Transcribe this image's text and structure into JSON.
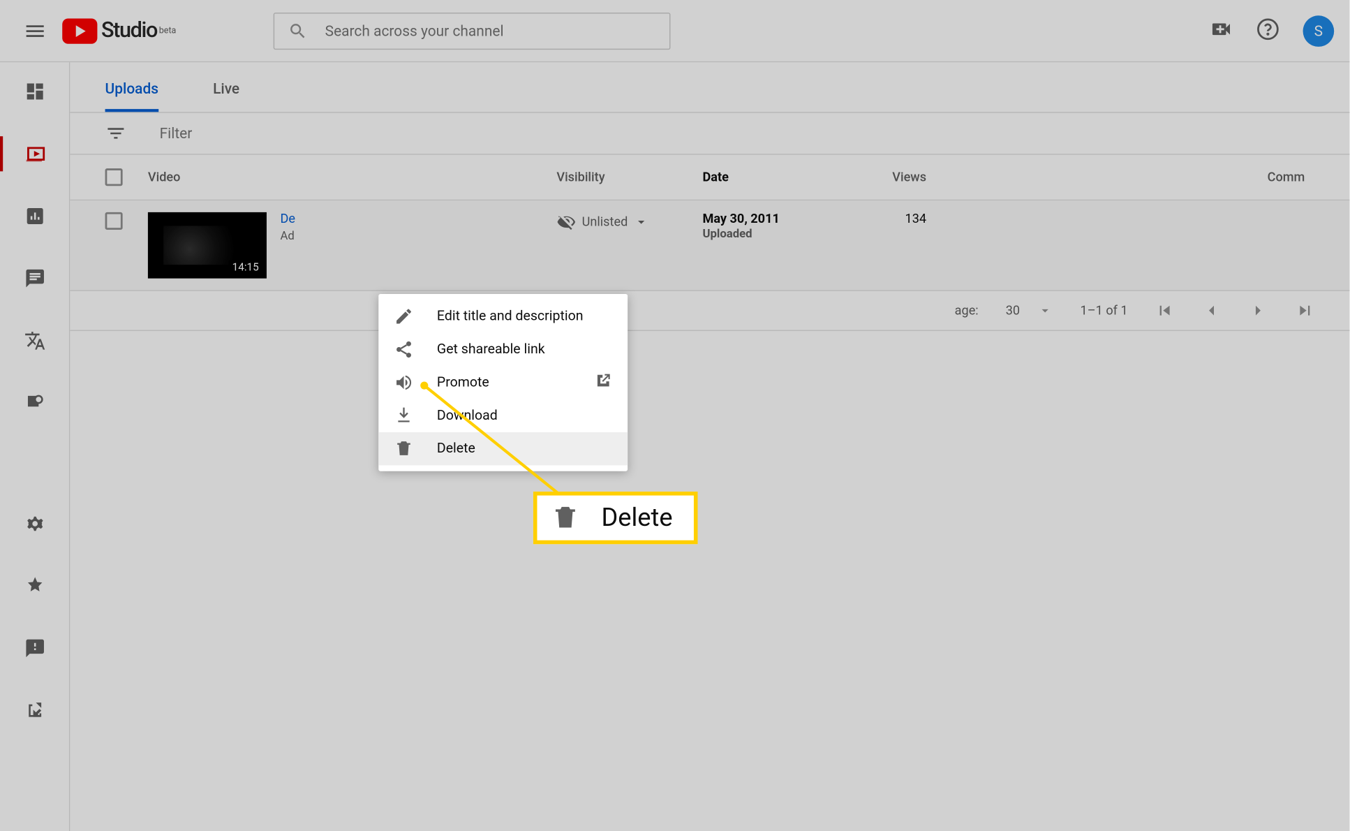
{
  "header": {
    "logo_text": "Studio",
    "logo_badge": "beta",
    "search_placeholder": "Search across your channel",
    "avatar_initial": "S"
  },
  "tabs": {
    "uploads": "Uploads",
    "live": "Live"
  },
  "filter": {
    "placeholder": "Filter"
  },
  "columns": {
    "video": "Video",
    "visibility": "Visibility",
    "date": "Date",
    "views": "Views",
    "comments": "Comm"
  },
  "row": {
    "title_prefix": "De",
    "desc_prefix": "Ad",
    "duration": "14:15",
    "visibility": "Unlisted",
    "date": "May 30, 2011",
    "date_sub": "Uploaded",
    "views": "134"
  },
  "pager": {
    "rows_label": "age:",
    "rows_value": "30",
    "range": "1–1 of 1"
  },
  "menu": {
    "edit": "Edit title and description",
    "share": "Get shareable link",
    "promote": "Promote",
    "download": "Download",
    "delete": "Delete"
  },
  "callout": {
    "label": "Delete"
  }
}
